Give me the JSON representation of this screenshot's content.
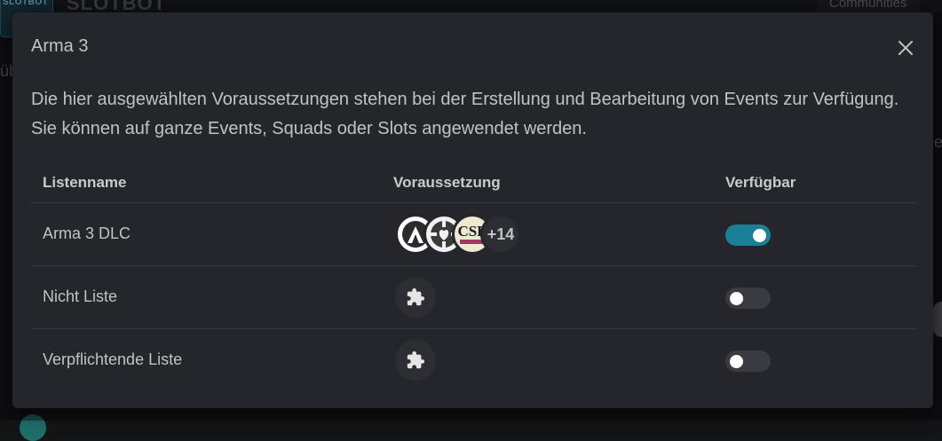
{
  "background": {
    "logo_text": "SLOTBOT",
    "brand": "SLOTBOT",
    "communities_label": "Communities",
    "left_fragment": "üb",
    "right_fragment": "e"
  },
  "modal": {
    "title": "Arma 3",
    "close_icon": "close-icon",
    "description": "Die hier ausgewählten Voraussetzungen stehen bei der Erstellung und Bearbeitung von Events zur Verfügung. Sie können auf ganze Events, Squads oder Slots angewendet werden.",
    "table": {
      "headers": [
        "Listenname",
        "Voraussetzung",
        "Verfügbar"
      ],
      "rows": [
        {
          "name": "Arma 3 DLC",
          "avatars": [
            "arma-logo",
            "gear-heart-logo",
            "csl-logo"
          ],
          "more": "+14",
          "available": true
        },
        {
          "name": "Nicht Liste",
          "avatars": [
            "puzzle-icon"
          ],
          "more": "",
          "available": false
        },
        {
          "name": "Verpflichtende Liste",
          "avatars": [
            "puzzle-icon"
          ],
          "more": "",
          "available": false
        }
      ]
    },
    "accent_color": "#1b8097"
  },
  "csl_text": "CSL"
}
